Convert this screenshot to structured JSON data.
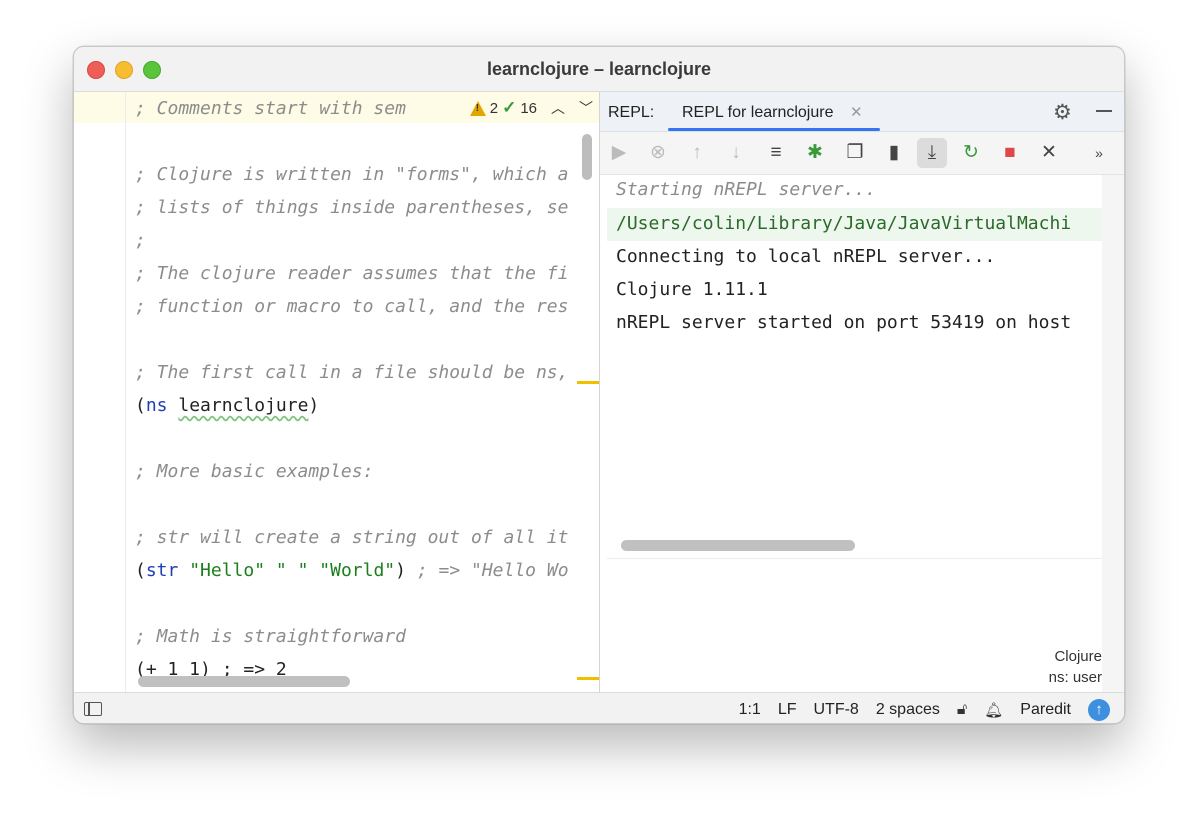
{
  "window": {
    "title": "learnclojure – learnclojure"
  },
  "editor": {
    "inspection": {
      "warnings": "2",
      "checks": "16"
    },
    "lines": [
      {
        "t": "; Comments start with sem",
        "k": "cm",
        "row": 0
      },
      {
        "t": "; Clojure is written in \"forms\", which a",
        "k": "cm",
        "row": 2
      },
      {
        "t": "; lists of things inside parentheses, se",
        "k": "cm",
        "row": 3
      },
      {
        "t": ";",
        "k": "cm",
        "row": 4
      },
      {
        "t": "; The clojure reader assumes that the fi",
        "k": "cm",
        "row": 5
      },
      {
        "t": "; function or macro to call, and the res",
        "k": "cm",
        "row": 6
      },
      {
        "t": "; The first call in a file should be ns,",
        "k": "cm",
        "row": 8
      },
      {
        "k": "ns",
        "row": 9,
        "open": "(",
        "kw": "ns",
        "sym": "learnclojure",
        "close": ")"
      },
      {
        "t": "; More basic examples:",
        "k": "cm",
        "row": 11
      },
      {
        "t": "; str will create a string out of all it",
        "k": "cm",
        "row": 13
      },
      {
        "k": "str",
        "row": 14,
        "open": "(",
        "kw": "str",
        "s1": "\"Hello\"",
        "s2": "\" \"",
        "s3": "\"World\"",
        "close": ")",
        "cmt": "; => \"Hello Wo"
      },
      {
        "t": "; Math is straightforward",
        "k": "cm",
        "row": 16
      },
      {
        "t": "(+ 1 1) ; => 2",
        "k": "plain",
        "row": 17
      }
    ]
  },
  "repl": {
    "label": "REPL:",
    "tab": "REPL for learnclojure",
    "console": [
      {
        "t": "Starting nREPL server...",
        "k": "italic"
      },
      {
        "t": "/Users/colin/Library/Java/JavaVirtualMachi",
        "k": "path"
      },
      {
        "t": "Connecting to local nREPL server...",
        "k": "plain"
      },
      {
        "t": "Clojure 1.11.1",
        "k": "plain"
      },
      {
        "t": "nREPL server started on port 53419 on host",
        "k": "plain"
      }
    ],
    "language": "Clojure",
    "ns": "ns: user"
  },
  "toolbar_icons": [
    "run-icon",
    "interrupt-icon",
    "history-up-icon",
    "history-down-icon",
    "soft-wrap-icon",
    "debug-icon",
    "copy-icon",
    "clear-icon",
    "scroll-to-end-icon",
    "reload-icon",
    "stop-icon",
    "close-icon",
    "more-icon"
  ],
  "status": {
    "position": "1:1",
    "line_sep": "LF",
    "encoding": "UTF-8",
    "indent": "2 spaces",
    "paredit": "Paredit"
  }
}
